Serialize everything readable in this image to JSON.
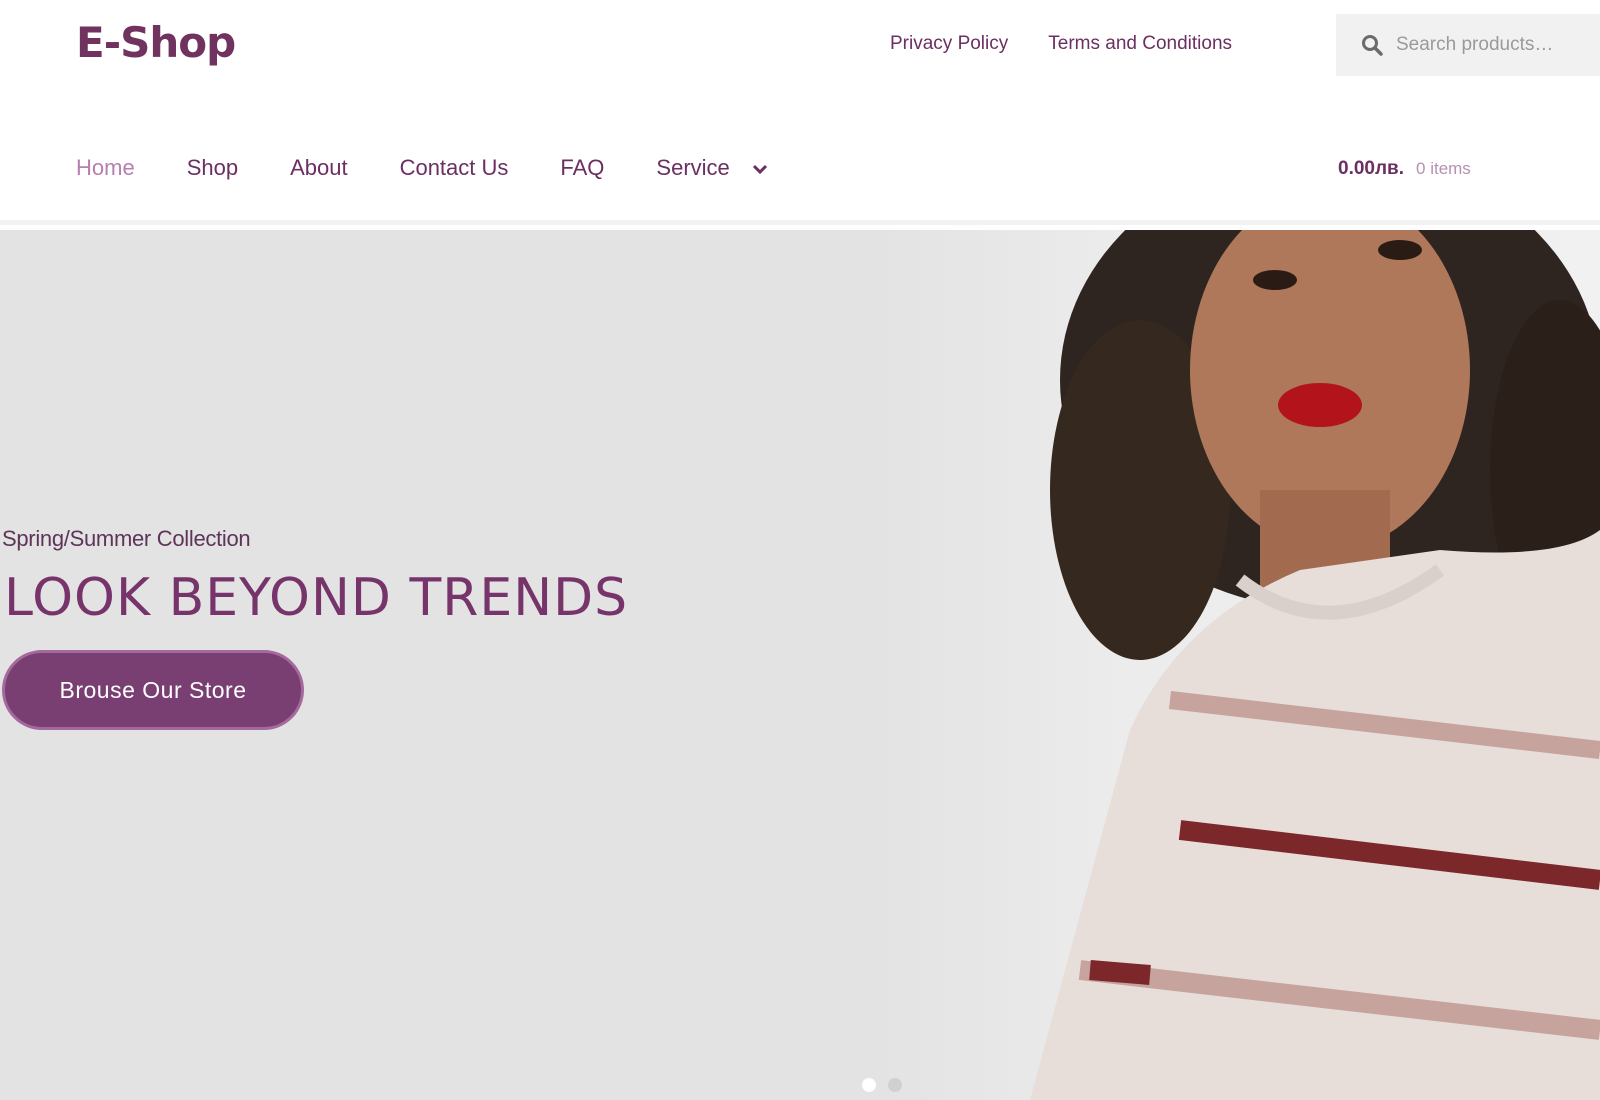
{
  "header": {
    "logo": "E-Shop",
    "secondary_nav": [
      "Privacy Policy",
      "Terms and Conditions"
    ],
    "search": {
      "placeholder": "Search products…"
    },
    "main_nav": [
      {
        "label": "Home",
        "active": true
      },
      {
        "label": "Shop"
      },
      {
        "label": "About"
      },
      {
        "label": "Contact Us"
      },
      {
        "label": "FAQ"
      },
      {
        "label": "Service",
        "has_dropdown": true
      }
    ],
    "cart": {
      "amount": "0.00лв.",
      "count": "0 items"
    }
  },
  "hero": {
    "subtitle": "Spring/Summer Collection",
    "title": "LOOK BEYOND TRENDS",
    "button_label": "Brouse Our Store",
    "slides": {
      "count": 2,
      "active": 1
    }
  },
  "colors": {
    "brand": "#70325f",
    "accent_light": "#b77fb0",
    "button": "#7a3f72",
    "hero_bg": "#e3e3e3"
  }
}
